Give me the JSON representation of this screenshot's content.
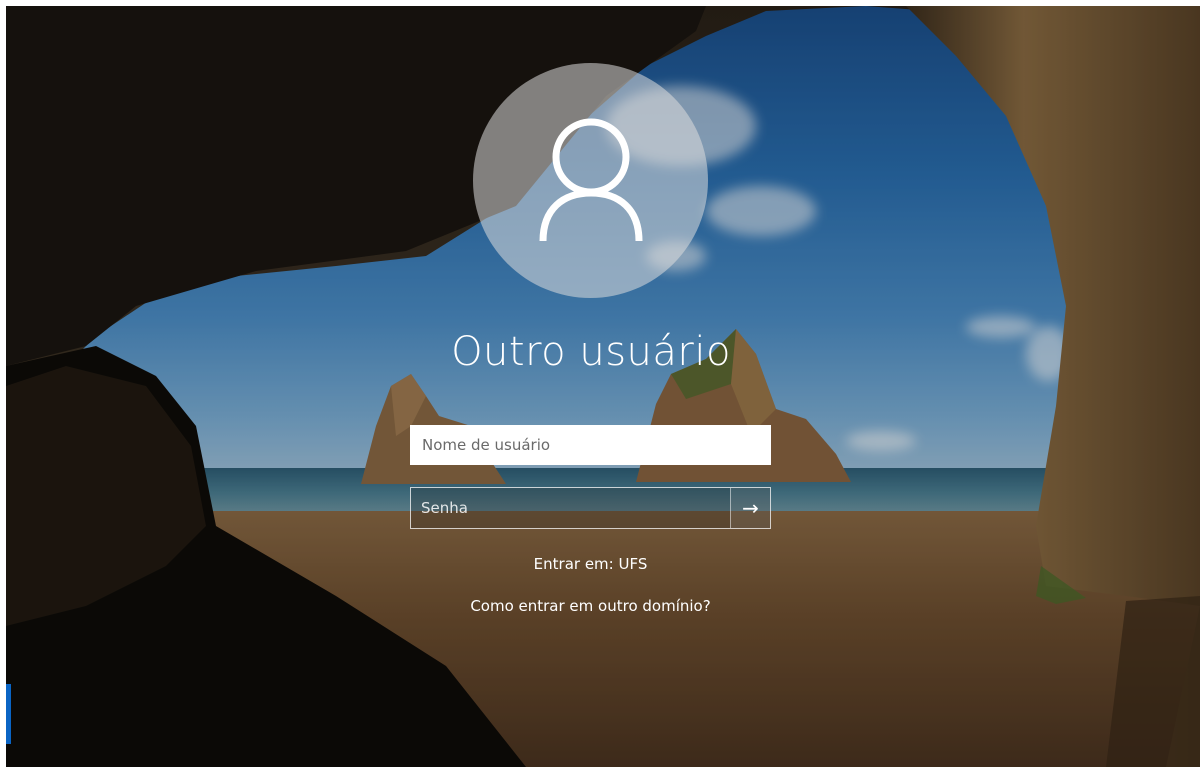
{
  "login": {
    "user_display_name": "Outro usuário",
    "username_placeholder": "Nome de usuário",
    "password_placeholder": "Senha",
    "submit_arrow": "→",
    "sign_in_to": "Entrar em: UFS",
    "other_domain_link": "Como entrar em outro domínio?"
  },
  "icons": {
    "avatar": "user-icon",
    "submit": "arrow-right-icon"
  },
  "colors": {
    "accent": "#0a64c4",
    "text": "#ffffff"
  }
}
